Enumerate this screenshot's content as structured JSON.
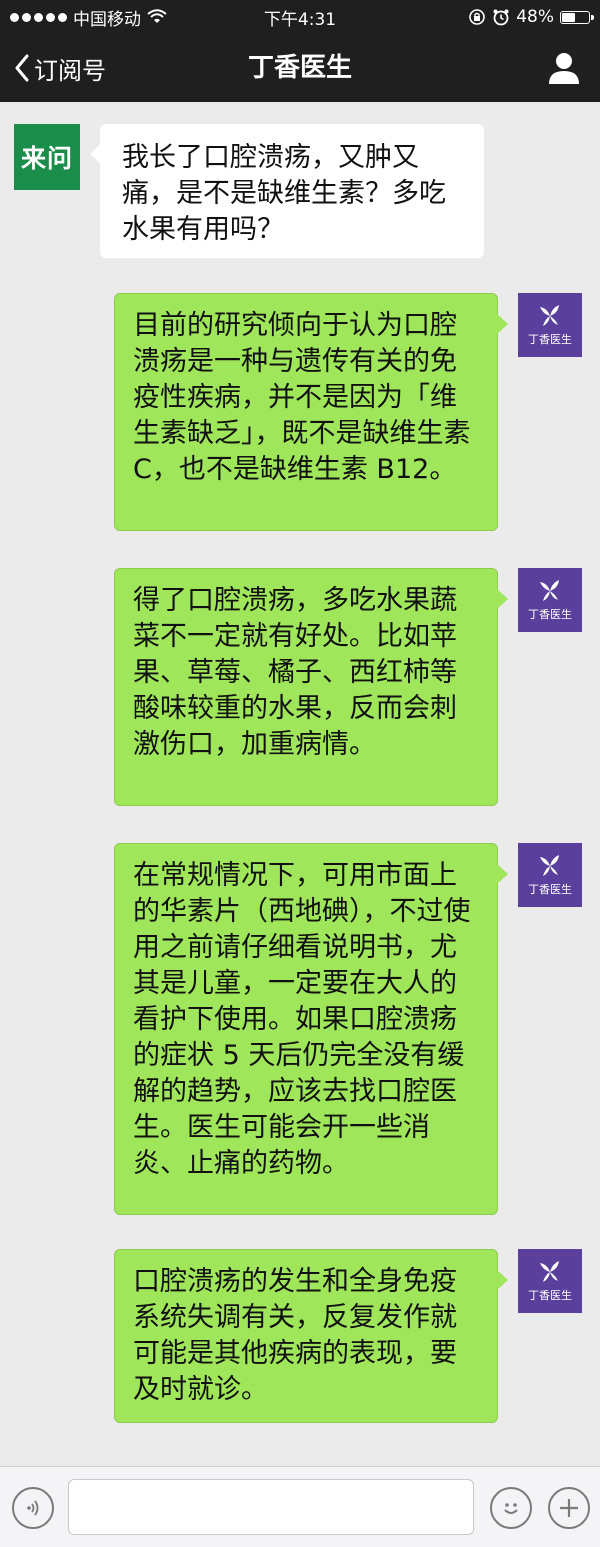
{
  "status_bar": {
    "carrier": "中国移动",
    "time": "下午4:31",
    "battery": "48%",
    "icons": [
      "signal-dots-icon",
      "wifi-icon",
      "rotation-lock-icon",
      "alarm-icon",
      "battery-icon"
    ]
  },
  "nav": {
    "back_label": "订阅号",
    "title": "丁香医生",
    "icons": [
      "chevron-left-icon",
      "person-icon"
    ]
  },
  "chat": {
    "user_avatar_text": "来问",
    "bot_avatar_brand": "丁香医生",
    "messages": [
      {
        "side": "left",
        "text": "我长了口腔溃疡，又肿又痛，是不是缺维生素？多吃水果有用吗？"
      },
      {
        "side": "right",
        "text": "目前的研究倾向于认为口腔溃疡是一种与遗传有关的免疫性疾病，并不是因为「维生素缺乏」，既不是缺维生素 C，也不是缺维生素 B12。"
      },
      {
        "side": "right",
        "text": "得了口腔溃疡，多吃水果蔬菜不一定就有好处。比如苹果、草莓、橘子、西红柿等酸味较重的水果，反而会刺激伤口，加重病情。"
      },
      {
        "side": "right",
        "text": "在常规情况下，可用市面上的华素片（西地碘），不过使用之前请仔细看说明书，尤其是儿童，一定要在大人的看护下使用。如果口腔溃疡的症状 5 天后仍完全没有缓解的趋势，应该去找口腔医生。医生可能会开一些消炎、止痛的药物。"
      },
      {
        "side": "right",
        "text": "口腔溃疡的发生和全身免疫系统失调有关，反复发作就可能是其他疾病的表现，要及时就诊。"
      }
    ]
  },
  "input_bar": {
    "icons": [
      "voice-icon",
      "emoji-icon",
      "plus-icon"
    ],
    "input_value": ""
  },
  "colors": {
    "bar_bg": "#1f1f1f",
    "chat_bg": "#ebebeb",
    "green_bubble": "#9fe65a",
    "user_avatar": "#1a8d4a",
    "brand_purple": "#5a3f9c"
  }
}
